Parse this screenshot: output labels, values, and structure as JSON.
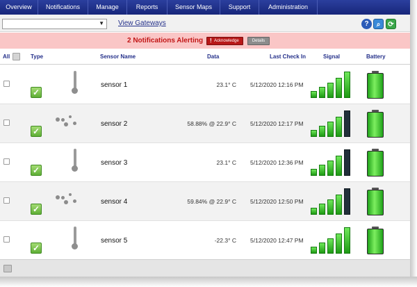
{
  "nav": {
    "items": [
      "Overview",
      "Notifications",
      "Manage",
      "Reports",
      "Sensor Maps",
      "Support",
      "Administration"
    ]
  },
  "toolbar": {
    "select_value": "",
    "gateways_link": "View Gateways",
    "icons": [
      "help-icon",
      "search-icon",
      "refresh-icon"
    ]
  },
  "alert": {
    "text": "2 Notifications Alerting",
    "acknowledge_label": "Acknowledge",
    "details_label": "Details"
  },
  "columns": {
    "all": "All",
    "type": "Type",
    "sensor_name": "Sensor Name",
    "data": "Data",
    "last_check_in": "Last Check In",
    "signal": "Signal",
    "battery": "Battery"
  },
  "sensors": [
    {
      "name": "sensor 1",
      "data": "23.1° C",
      "check_in": "5/12/2020 12:16 PM",
      "kind": "thermometer-icon",
      "signal_bars": 5,
      "battery_level": 1.0
    },
    {
      "name": "sensor 2",
      "data": "58.88% @ 22.9° C",
      "check_in": "5/12/2020 12:17 PM",
      "kind": "humidity-icon",
      "signal_bars": 4,
      "battery_level": 1.0
    },
    {
      "name": "sensor 3",
      "data": "23.1° C",
      "check_in": "5/12/2020 12:36 PM",
      "kind": "thermometer-icon",
      "signal_bars": 4,
      "battery_level": 1.0
    },
    {
      "name": "sensor 4",
      "data": "59.84% @ 22.9° C",
      "check_in": "5/12/2020 12:50 PM",
      "kind": "humidity-icon",
      "signal_bars": 4,
      "battery_level": 1.0
    },
    {
      "name": "sensor 5",
      "data": "-22.3° C",
      "check_in": "5/12/2020 12:47 PM",
      "kind": "thermometer-icon",
      "signal_bars": 5,
      "battery_level": 1.0
    }
  ],
  "colors": {
    "nav_bg": "#1f2f8a",
    "alert_bg": "#fac6c6",
    "alert_text": "#c21616",
    "header_text": "#24308a",
    "signal_on": "#2fbf22",
    "signal_off": "#22303a",
    "battery": "#2bb524"
  }
}
